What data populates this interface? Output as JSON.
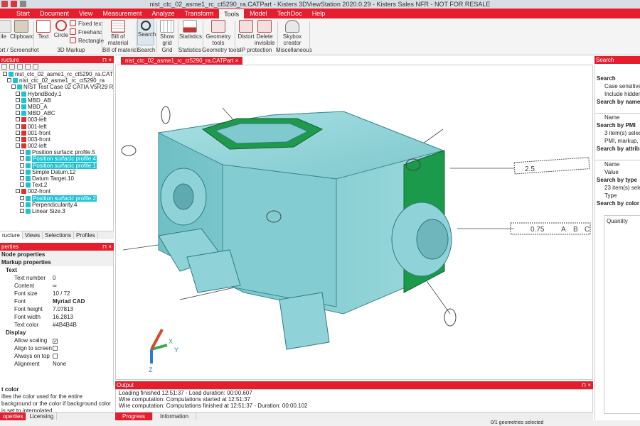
{
  "window": {
    "title": "nist_ctc_02_asme1_rc_ct5290_ra.CATPart - Kisters 3DViewStation 2020.0.29 - Kisters Sales NFR - NOT FOR RESALE"
  },
  "ribbon_tabs": [
    "Start",
    "Document",
    "View",
    "Measurement",
    "Analyze",
    "Transform",
    "Tools",
    "Model",
    "TechDoc",
    "Help"
  ],
  "active_tab": "Tools",
  "ribbon": {
    "buttons": {
      "file": "ile",
      "clipboard": "Clipboard",
      "text": "Text",
      "circle": "Circle",
      "fixed_text": "Fixed text",
      "freehand": "Freehand",
      "rectangle": "Rectangle",
      "bill_of_material": "Bill of material",
      "search": "Search",
      "show_grid": "Show grid",
      "statistics": "Statistics",
      "geometry_tools": "Geometry tools",
      "distort": "Distort",
      "delete_invisible": "Delete invisible",
      "skybox_creator": "Skybox creator"
    },
    "groups": {
      "export": "ort / Screenshot",
      "markup": "3D Markup",
      "bom": "Bill of material",
      "search": "Search",
      "grid": "Grid",
      "statistics": "Statistics",
      "geometry": "Geometry tools",
      "ip": "IP protection",
      "misc": "Miscellaneous"
    }
  },
  "structure_panel": {
    "title": "ructure",
    "items": [
      "nist_ctc_02_asme1_rc_ct5290_ra.CATPart",
      "nist_ctc_02_asme1_rc_ct5290_ra",
      "NIST Test Case 02 CATIA V5R29 RB",
      "HybridBody.1",
      "MBD_AB",
      "MBD_A",
      "MBD_ABC",
      "003-left",
      "001-left",
      "001-front",
      "003-front",
      "002-left",
      "Position surfacic profile.5",
      "Position surfacic profile.4",
      "Position surfacic profile.1",
      "Simple Datum.12",
      "Datum Target.10",
      "Text.2",
      "002-front",
      "Position surfacic profile.2",
      "Perpendicularity.4",
      "Linear Size.3"
    ],
    "tabs": [
      "ructure",
      "Views",
      "Selections",
      "Profiles"
    ]
  },
  "properties_panel": {
    "title": "perties",
    "node": "Node properties",
    "section": "Markup properties",
    "text_group": "Text",
    "rows": [
      {
        "k": "Text number",
        "v": "0"
      },
      {
        "k": "Content",
        "v": "∞"
      },
      {
        "k": "Font size",
        "v": "10 / 72"
      },
      {
        "k": "Font",
        "v": "Myriad CAD"
      },
      {
        "k": "Font height",
        "v": "7.07813"
      },
      {
        "k": "Font width",
        "v": "16.2813"
      },
      {
        "k": "Text color",
        "v": "#4B4B4B"
      }
    ],
    "display_group": "Display",
    "display_rows": [
      "Allow scaling",
      "Align to screen",
      "Always on top",
      "Alignment"
    ],
    "alignment_value": "None",
    "desc_title": "t color",
    "desc_text": "ifies the color used for the entire background or the color if background color is set to interpolated.",
    "bottom_tabs": [
      "operties",
      "Licensing"
    ]
  },
  "document_tab": "nist_ctc_02_asme1_rc_ct5290_ra.CATPart",
  "viewport": {
    "annotations": [
      "2.5",
      "0.75",
      "A",
      "B",
      "C",
      "B"
    ],
    "axes": [
      "X",
      "Y",
      "Z"
    ]
  },
  "output_panel": {
    "title": "Output",
    "lines": [
      "Loading finished 12:51:37 - Load duration: 00:00.607",
      "Wire computation: Computations started at 12:51:37",
      "Wire computation: Computations finished at 12:51:37 - Duration: 00:00.102"
    ],
    "tabs": [
      "Progress",
      "Information"
    ]
  },
  "search_panel": {
    "title": "Search",
    "rows": [
      {
        "t": "h",
        "s": "Search"
      },
      {
        "t": "i",
        "s": "Case sensitive"
      },
      {
        "t": "i",
        "s": "Include hidden g"
      },
      {
        "t": "h",
        "s": "Search by name"
      },
      {
        "t": "i",
        "s": ""
      },
      {
        "t": "i",
        "s": "Name"
      },
      {
        "t": "h",
        "s": "Search by PMI"
      },
      {
        "t": "i",
        "s": "3 item(s) selected"
      },
      {
        "t": "i",
        "s": "PMI, markup, tex"
      },
      {
        "t": "h",
        "s": "Search by attrib"
      },
      {
        "t": "i",
        "s": ""
      },
      {
        "t": "i",
        "s": "Name"
      },
      {
        "t": "i",
        "s": "Value"
      },
      {
        "t": "h",
        "s": "Search by type"
      },
      {
        "t": "i",
        "s": "23 item(s) selected"
      },
      {
        "t": "i",
        "s": "Type"
      },
      {
        "t": "h",
        "s": "Search by color"
      }
    ],
    "quantity": "Quantity"
  },
  "status": "0/1 geometries selected",
  "colors": {
    "accent": "#e51e2d",
    "selection": "#1fc2d4",
    "model": "#8fd3d8",
    "face_green": "#1a9a4a"
  }
}
